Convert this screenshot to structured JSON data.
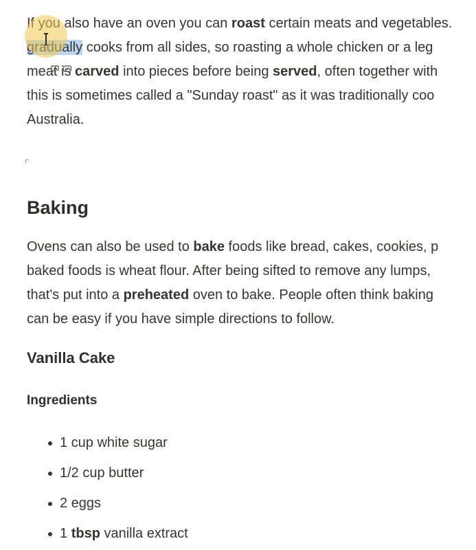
{
  "paragraphs": {
    "oven_roast": {
      "line1": {
        "a": "If you also have an oven you can ",
        "b_roast": "roast",
        "c": " certain meats and vegetables."
      },
      "line2": {
        "sel": "gradually",
        "a": " cooks from all sides, so roasting a whole chicken or a leg"
      },
      "line3": {
        "a": "meat is ",
        "b_carved": "carved",
        "c": " into pieces before being ",
        "d_served": "served",
        "e": ", often together with"
      },
      "line4": "this is sometimes called a \"Sunday roast\" as it was traditionally coo",
      "line5": "Australia."
    },
    "baking_intro": {
      "line1": {
        "a": "Ovens can also be used to ",
        "b_bake": "bake",
        "c": " foods like bread, cakes, cookies, p"
      },
      "line2": "baked foods is wheat flour. After being sifted to remove any lumps,",
      "line3": {
        "a": "that's put into a ",
        "b_preheated": "preheated",
        "c": " oven to bake. People often think baking"
      },
      "line4": "can be easy if you have simple directions to follow."
    }
  },
  "headings": {
    "baking": "Baking",
    "vanilla_cake": "Vanilla Cake",
    "ingredients": "Ingredients"
  },
  "ingredients": [
    {
      "text": "1 cup white sugar"
    },
    {
      "text": "1/2 cup butter"
    },
    {
      "text": "2 eggs"
    },
    {
      "pre": "1 ",
      "bold": "tbsp",
      "post": " vanilla extract"
    }
  ],
  "icons": {
    "cursor": "text-cursor-icon",
    "tool_a": "comment-icon",
    "tool_b": "link-icon"
  },
  "colors": {
    "text": "#37352f",
    "selection": "#b9d6f5",
    "cursor_halo": "#eec850"
  }
}
